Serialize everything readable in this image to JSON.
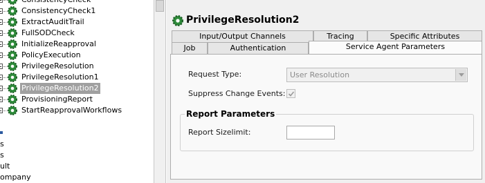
{
  "tree": {
    "items": [
      {
        "label": "ConsistencyCheck",
        "selected": false
      },
      {
        "label": "ConsistencyCheck1",
        "selected": false
      },
      {
        "label": "ExtractAuditTrail",
        "selected": false
      },
      {
        "label": "FullSODCheck",
        "selected": false
      },
      {
        "label": "InitializeReapproval",
        "selected": false
      },
      {
        "label": "PolicyExecution",
        "selected": false
      },
      {
        "label": "PrivilegeResolution",
        "selected": false
      },
      {
        "label": "PrivilegeResolution1",
        "selected": false
      },
      {
        "label": "PrivilegeResolution2",
        "selected": true
      },
      {
        "label": "ProvisioningReport",
        "selected": false
      },
      {
        "label": "StartReapprovalWorkflows",
        "selected": false
      }
    ],
    "partial_items": [
      "s",
      "s",
      "ult",
      "ompany"
    ]
  },
  "panel": {
    "title": "PrivilegeResolution2",
    "tabs_row1": [
      "Input/Output Channels",
      "Tracing",
      "Specific Attributes"
    ],
    "tabs_row2": [
      "Job",
      "Authentication",
      "Service Agent Parameters"
    ],
    "active_tab": "Service Agent Parameters",
    "form": {
      "request_type_label": "Request Type:",
      "request_type_value": "User Resolution",
      "suppress_label": "Suppress Change Events:",
      "suppress_checked": true,
      "report_group_title": "Report Parameters",
      "sizelimit_label": "Report Sizelimit:",
      "sizelimit_value": ""
    }
  },
  "icons": {
    "tree_item_icon": "gear-icon",
    "title_icon": "gear-icon"
  },
  "colors": {
    "gear_green": "#2e8b3a",
    "selection_gray": "#a0a0a0",
    "panel_bg": "#f0f0f0"
  }
}
